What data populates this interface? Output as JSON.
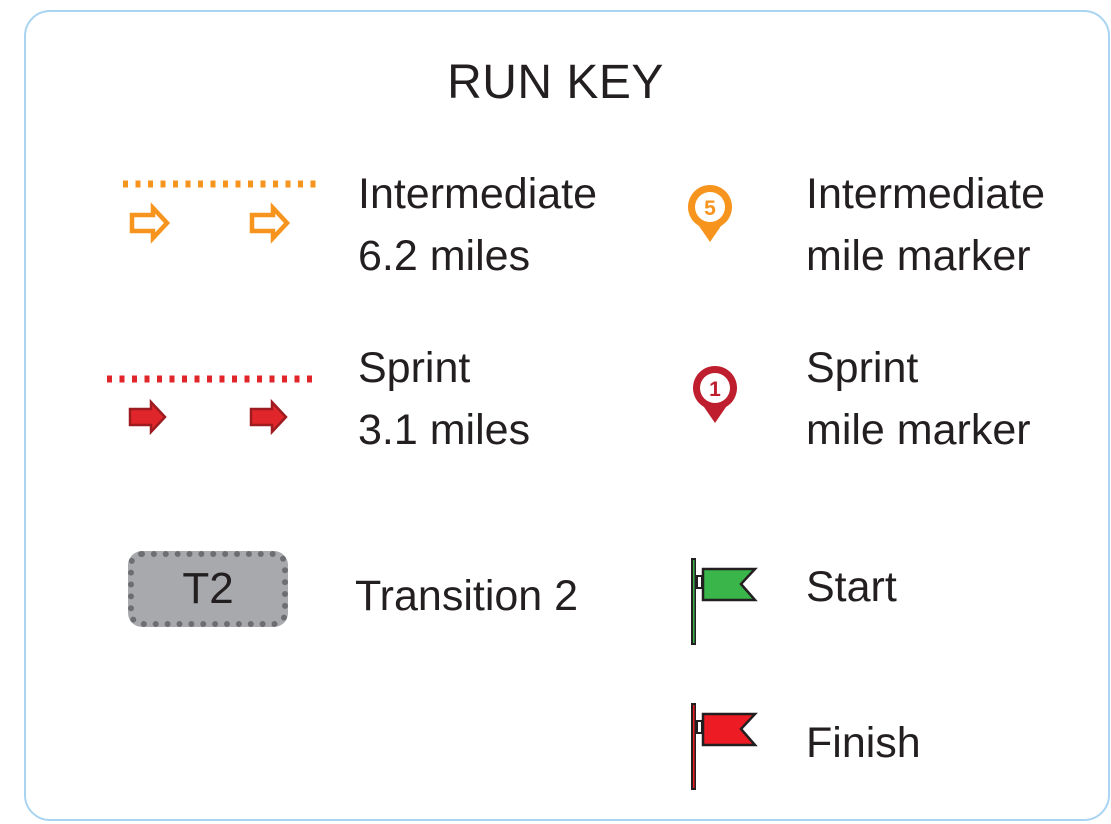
{
  "title": "RUN KEY",
  "items": {
    "intermediate_route": {
      "line1": "Intermediate",
      "line2": "6.2 miles",
      "color": "#f7941d",
      "symbol": "dotted-line-with-outline-arrows"
    },
    "intermediate_marker": {
      "line1": "Intermediate",
      "line2": "mile marker",
      "number": "5",
      "color": "#f7941d",
      "symbol": "map-pin-icon"
    },
    "sprint_route": {
      "line1": "Sprint",
      "line2": "3.1 miles",
      "color": "#e0262b",
      "symbol": "dotted-line-with-solid-arrows"
    },
    "sprint_marker": {
      "line1": "Sprint",
      "line2": "mile marker",
      "number": "1",
      "color": "#be1e2d",
      "symbol": "map-pin-icon"
    },
    "transition": {
      "badge": "T2",
      "label": "Transition 2",
      "color": "#a7a9ac"
    },
    "start": {
      "label": "Start",
      "color": "#39b54a",
      "symbol": "flag-icon"
    },
    "finish": {
      "label": "Finish",
      "color": "#ed1c24",
      "symbol": "flag-icon"
    }
  }
}
